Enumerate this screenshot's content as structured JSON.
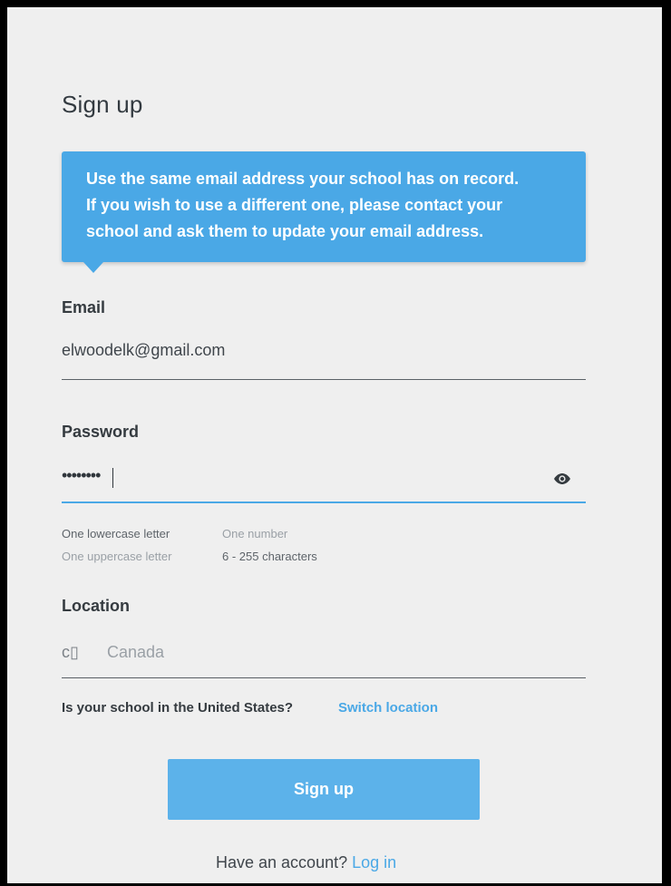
{
  "page": {
    "title": "Sign up"
  },
  "notice": {
    "lines": [
      "Use the same email address your school has on record.",
      "If you wish to use a different one, please contact your",
      "school and ask them to update your email address."
    ]
  },
  "email": {
    "label": "Email",
    "value": "elwoodelk@gmail.com"
  },
  "password": {
    "label": "Password",
    "masked_value": "••••••••",
    "toggle_icon": "eye-icon",
    "requirements": [
      {
        "text": "One lowercase letter",
        "met": false
      },
      {
        "text": "One uppercase letter",
        "met": true
      },
      {
        "text": "One number",
        "met": true
      },
      {
        "text": "6 - 255 characters",
        "met": false
      }
    ]
  },
  "location": {
    "label": "Location",
    "icon_glyph": "c▯",
    "value": "Canada",
    "question": "Is your school in the United States?",
    "switch_link": "Switch location"
  },
  "actions": {
    "signup_label": "Sign up",
    "have_account": "Have an account?",
    "login_link": "Log in"
  },
  "colors": {
    "accent": "#4aa8e6",
    "button": "#5cb2ea",
    "background": "#efefef"
  }
}
